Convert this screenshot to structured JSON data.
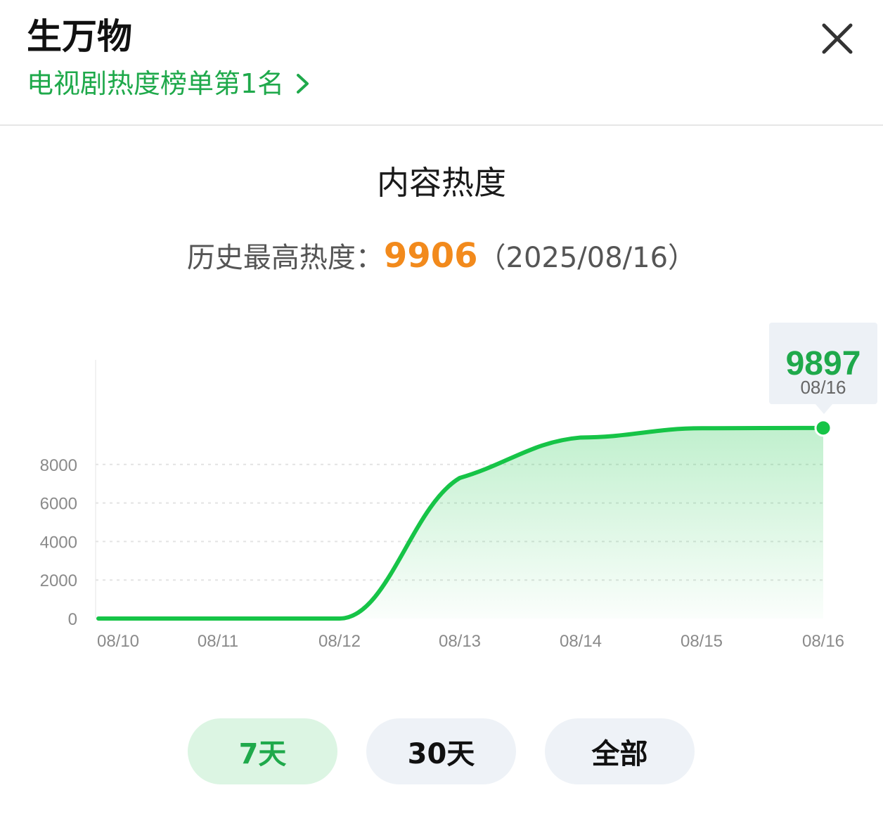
{
  "header": {
    "title": "生万物",
    "rank_link_label": "电视剧热度榜单第1名",
    "close_icon": "close-icon",
    "chevron_icon": "chevron-right-icon"
  },
  "section": {
    "title": "内容热度",
    "peak_label": "历史最高热度：",
    "peak_value": "9906",
    "peak_date": "（2025/08/16）"
  },
  "tooltip": {
    "value": "9897",
    "date": "08/16"
  },
  "range_tabs": [
    {
      "label": "7天",
      "active": true
    },
    {
      "label": "30天",
      "active": false
    },
    {
      "label": "全部",
      "active": false
    }
  ],
  "colors": {
    "accent_green": "#1fa94b",
    "line_green": "#16c447",
    "peak_orange": "#f28a1c"
  },
  "chart_data": {
    "type": "area",
    "categories": [
      "08/10",
      "08/11",
      "08/12",
      "08/13",
      "08/14",
      "08/15",
      "08/16"
    ],
    "values": [
      0,
      0,
      0,
      7300,
      9400,
      9880,
      9897
    ],
    "yticks": [
      0,
      2000,
      4000,
      6000,
      8000
    ],
    "ylim": [
      0,
      10000
    ],
    "grid": true,
    "title": "",
    "xlabel": "",
    "ylabel": ""
  }
}
